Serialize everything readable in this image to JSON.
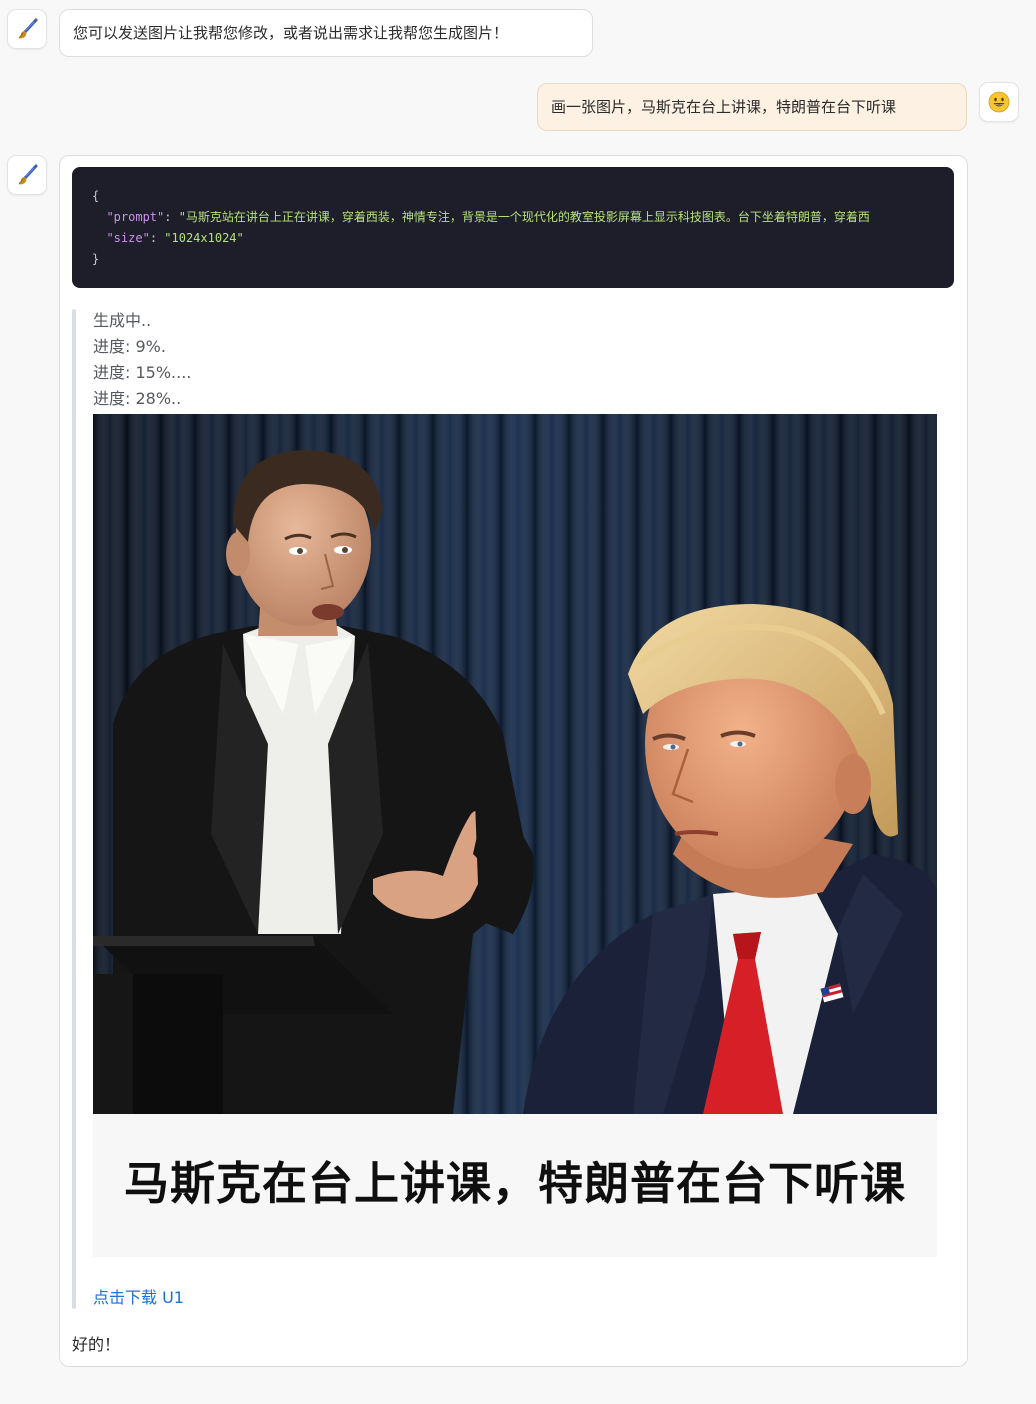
{
  "messages": {
    "bot_greeting": "您可以发送图片让我帮您修改，或者说出需求让我帮您生成图片！",
    "user_request": "画一张图片，马斯克在台上讲课，特朗普在台下听课",
    "final_reply": "好的！"
  },
  "code": {
    "open_brace": "{",
    "prompt_key": "\"prompt\"",
    "prompt_value": "\"马斯克站在讲台上正在讲课，穿着西装，神情专注，背景是一个现代化的教室投影屏幕上显示科技图表。台下坐着特朗普，穿着西",
    "size_key": "\"size\"",
    "size_value": "\"1024x1024\"",
    "close_brace": "}"
  },
  "progress": {
    "line1": "生成中..",
    "line2": "进度: 9%.",
    "line3": "进度: 15%....",
    "line4": "进度: 28%.."
  },
  "image": {
    "caption": "马斯克在台上讲课，特朗普在台下听课"
  },
  "download": {
    "label": "点击下载 U1"
  },
  "icons": {
    "bot_avatar": "paintbrush-icon",
    "user_avatar": "smiley-face-icon"
  },
  "colors": {
    "page_bg": "#f8f8f8",
    "user_bubble": "#fcf1e2",
    "code_bg": "#1e1e2a",
    "link": "#1a72d6"
  }
}
